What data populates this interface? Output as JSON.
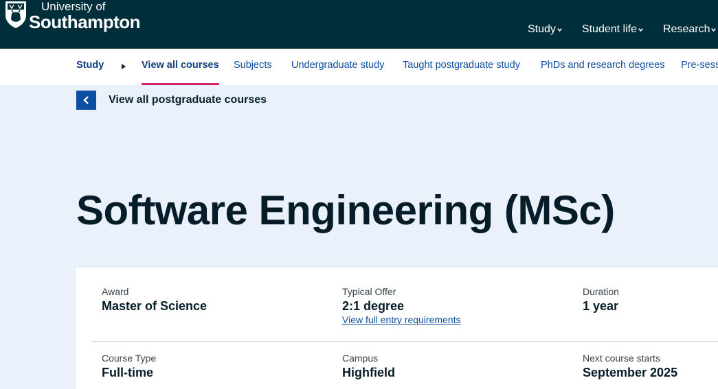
{
  "header": {
    "logo_line1": "University of",
    "logo_line2": "Southampton",
    "nav": [
      "Study",
      "Student life",
      "Research"
    ]
  },
  "subnav": {
    "items": [
      "Study",
      "View all courses",
      "Subjects",
      "Undergraduate study",
      "Taught postgraduate study",
      "PhDs and research degrees",
      "Pre-sess"
    ]
  },
  "back": {
    "label": "View all postgraduate courses"
  },
  "page": {
    "title": "Software Engineering (MSc)"
  },
  "facts": {
    "award": {
      "label": "Award",
      "value": "Master of Science"
    },
    "offer": {
      "label": "Typical Offer",
      "value": "2:1 degree",
      "link": "View full entry requirements"
    },
    "duration": {
      "label": "Duration",
      "value": "1 year"
    },
    "type": {
      "label": "Course Type",
      "value": "Full-time"
    },
    "campus": {
      "label": "Campus",
      "value": "Highfield"
    },
    "start": {
      "label": "Next course starts",
      "value": "September 2025"
    }
  },
  "colors": {
    "header_bg": "#002e3b",
    "accent_pink": "#d4236c",
    "link_blue": "#0c4da2",
    "page_bg": "#eaf1fa"
  }
}
